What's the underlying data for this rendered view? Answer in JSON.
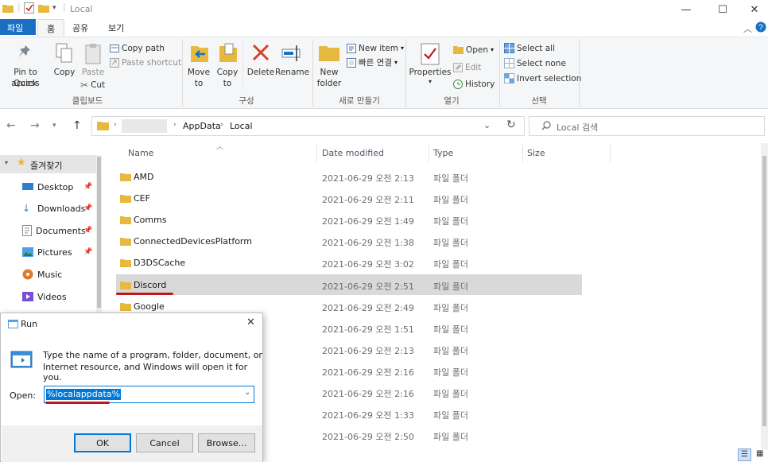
{
  "window": {
    "title": "Local"
  },
  "ribbon_tabs": [
    "파일",
    "홈",
    "공유",
    "보기"
  ],
  "ribbon": {
    "pin_label_1": "Pin to Quick",
    "pin_label_2": "access",
    "copy": "Copy",
    "paste": "Paste",
    "copy_path": "Copy path",
    "paste_shortcut": "Paste shortcut",
    "cut": "Cut",
    "clipboard_group": "클립보드",
    "move_to_1": "Move",
    "move_to_2": "to",
    "copy_to_1": "Copy",
    "copy_to_2": "to",
    "delete": "Delete",
    "rename": "Rename",
    "organize_group": "구성",
    "new_folder_1": "New",
    "new_folder_2": "folder",
    "new_item": "New item",
    "easy_access": "빠른 연결",
    "new_group": "새로 만들기",
    "properties": "Properties",
    "open": "Open",
    "edit": "Edit",
    "history": "History",
    "open_group": "열기",
    "select_all": "Select all",
    "select_none": "Select none",
    "invert_selection": "Invert selection",
    "select_group": "선택"
  },
  "address": {
    "crumbs": [
      "AppData",
      "Local"
    ],
    "search_placeholder": "Local 검색"
  },
  "nav": {
    "quick_access": "즐겨찾기",
    "items": [
      "Desktop",
      "Downloads",
      "Documents",
      "Pictures",
      "Music",
      "Videos"
    ]
  },
  "columns": {
    "name": "Name",
    "date": "Date modified",
    "type": "Type",
    "size": "Size"
  },
  "files": [
    {
      "name": "AMD",
      "date": "2021-06-29 오전 2:13",
      "type": "파일 폴더"
    },
    {
      "name": "CEF",
      "date": "2021-06-29 오전 2:11",
      "type": "파일 폴더"
    },
    {
      "name": "Comms",
      "date": "2021-06-29 오전 1:49",
      "type": "파일 폴더"
    },
    {
      "name": "ConnectedDevicesPlatform",
      "date": "2021-06-29 오전 1:38",
      "type": "파일 폴더"
    },
    {
      "name": "D3DSCache",
      "date": "2021-06-29 오전 3:02",
      "type": "파일 폴더"
    },
    {
      "name": "Discord",
      "date": "2021-06-29 오전 2:51",
      "type": "파일 폴더"
    },
    {
      "name": "Google",
      "date": "2021-06-29 오전 2:49",
      "type": "파일 폴더"
    },
    {
      "name": "",
      "date": "2021-06-29 오전 1:51",
      "type": "파일 폴더"
    },
    {
      "name": "",
      "date": "2021-06-29 오전 2:13",
      "type": "파일 폴더"
    },
    {
      "name": "",
      "date": "2021-06-29 오전 2:16",
      "type": "파일 폴더"
    },
    {
      "name": "",
      "date": "2021-06-29 오전 2:16",
      "type": "파일 폴더"
    },
    {
      "name": "",
      "date": "2021-06-29 오전 1:33",
      "type": "파일 폴더"
    },
    {
      "name": "",
      "date": "2021-06-29 오전 2:50",
      "type": "파일 폴더"
    }
  ],
  "run": {
    "title": "Run",
    "description_1": "Type the name of a program, folder, document, or",
    "description_2": "Internet resource, and Windows will open it for you.",
    "open_label": "Open:",
    "value": "%localappdata%",
    "ok": "OK",
    "cancel": "Cancel",
    "browse": "Browse..."
  },
  "colors": {
    "accent": "#1a6fc2",
    "folder": "#e8b93f",
    "underline": "#c0161b",
    "selection": "#d9d9d9"
  }
}
